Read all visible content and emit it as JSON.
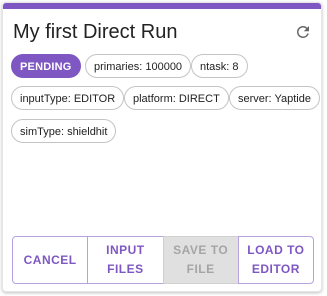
{
  "card": {
    "title": "My first Direct Run",
    "accent_color": "#7e57c2",
    "refresh_icon": "refresh-icon"
  },
  "chips": {
    "status": "PENDING",
    "primaries": "primaries: 100000",
    "ntask": "ntask: 8",
    "input_type": "inputType: EDITOR",
    "platform": "platform: DIRECT",
    "server": "server: Yaptide",
    "sim_type": "simType: shieldhit"
  },
  "actions": {
    "cancel": "CANCEL",
    "input_files_line1": "INPUT",
    "input_files_line2": "FILES",
    "save_to_file_line1": "SAVE TO",
    "save_to_file_line2": "FILE",
    "load_to_editor_line1": "LOAD TO",
    "load_to_editor_line2": "EDITOR"
  }
}
